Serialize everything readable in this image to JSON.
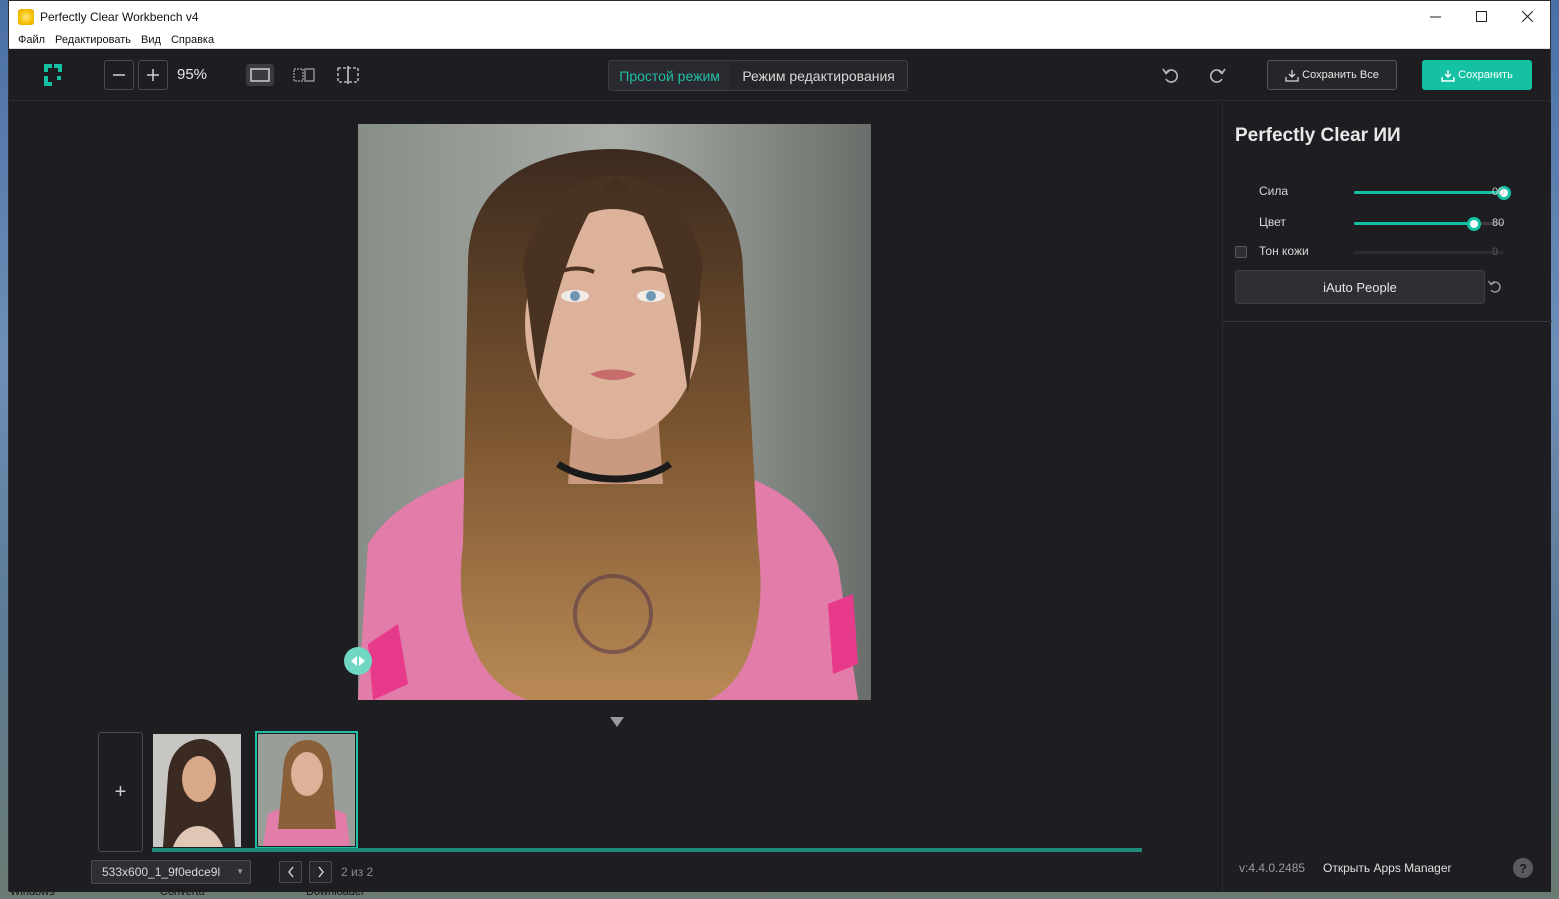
{
  "window": {
    "title": "Perfectly Clear Workbench v4"
  },
  "menu": [
    "Файл",
    "Редактировать",
    "Вид",
    "Справка"
  ],
  "toolbar": {
    "zoom": "95%",
    "mode_simple": "Простой режим",
    "mode_edit": "Режим редактирования",
    "save_all": "Сохранить Все",
    "save": "Сохранить"
  },
  "panel": {
    "title": "Perfectly Clear ИИ",
    "sliders": [
      {
        "label": "Сила",
        "value": "00",
        "level": 1.0,
        "enabled": true
      },
      {
        "label": "Цвет",
        "value": "80",
        "level": 0.8,
        "enabled": true
      },
      {
        "label": "Тон кожи",
        "value": "0",
        "level": 0.0,
        "enabled": false
      }
    ],
    "preset_button": "iAuto People",
    "version": "v:4.4.0.2485",
    "apps_manager": "Открыть Apps Manager",
    "help": "?"
  },
  "filmstrip": {
    "add": "+",
    "file_name": "533x600_1_9f0edce9l",
    "page_count": "2 из 2"
  },
  "desktop": {
    "taskbar_labels": [
      "Windows",
      "Convertu",
      "Downloader"
    ]
  },
  "colors": {
    "accent": "#14c2a3",
    "background": "#1e1e22"
  }
}
